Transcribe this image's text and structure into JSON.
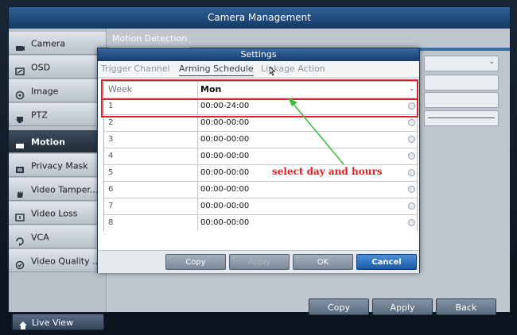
{
  "window": {
    "title": "Camera Management"
  },
  "sidebar": {
    "items": [
      {
        "label": "Camera",
        "icon": "camera-icon"
      },
      {
        "label": "OSD",
        "icon": "osd-icon"
      },
      {
        "label": "Image",
        "icon": "image-icon"
      },
      {
        "label": "PTZ",
        "icon": "ptz-icon"
      },
      {
        "label": "Motion",
        "icon": "motion-icon",
        "active": true
      },
      {
        "label": "Privacy Mask",
        "icon": "privacy-mask-icon"
      },
      {
        "label": "Video Tamper...",
        "icon": "video-tamper-icon"
      },
      {
        "label": "Video Loss",
        "icon": "video-loss-icon"
      },
      {
        "label": "VCA",
        "icon": "vca-icon"
      },
      {
        "label": "Video Quality ...",
        "icon": "video-quality-icon"
      }
    ],
    "live_view": "Live View"
  },
  "content": {
    "tab_label": "Motion Detection",
    "buttons": {
      "copy": "Copy",
      "apply": "Apply",
      "back": "Back"
    }
  },
  "dialog": {
    "title": "Settings",
    "tabs": [
      {
        "label": "Trigger Channel"
      },
      {
        "label": "Arming Schedule",
        "active": true
      },
      {
        "label": "Linkage Action"
      }
    ],
    "week": {
      "label": "Week",
      "value": "Mon"
    },
    "schedule_rows": [
      {
        "index": "1",
        "time": "00:00-24:00"
      },
      {
        "index": "2",
        "time": "00:00-00:00"
      },
      {
        "index": "3",
        "time": "00:00-00:00"
      },
      {
        "index": "4",
        "time": "00:00-00:00"
      },
      {
        "index": "5",
        "time": "00:00-00:00"
      },
      {
        "index": "6",
        "time": "00:00-00:00"
      },
      {
        "index": "7",
        "time": "00:00-00:00"
      },
      {
        "index": "8",
        "time": "00:00-00:00"
      }
    ],
    "buttons": {
      "copy": "Copy",
      "apply": "Apply",
      "ok": "OK",
      "cancel": "Cancel"
    }
  },
  "annotation": {
    "text": "select day and hours",
    "highlight_color": "#d9242b",
    "arrow_color": "#3fbf3f"
  }
}
